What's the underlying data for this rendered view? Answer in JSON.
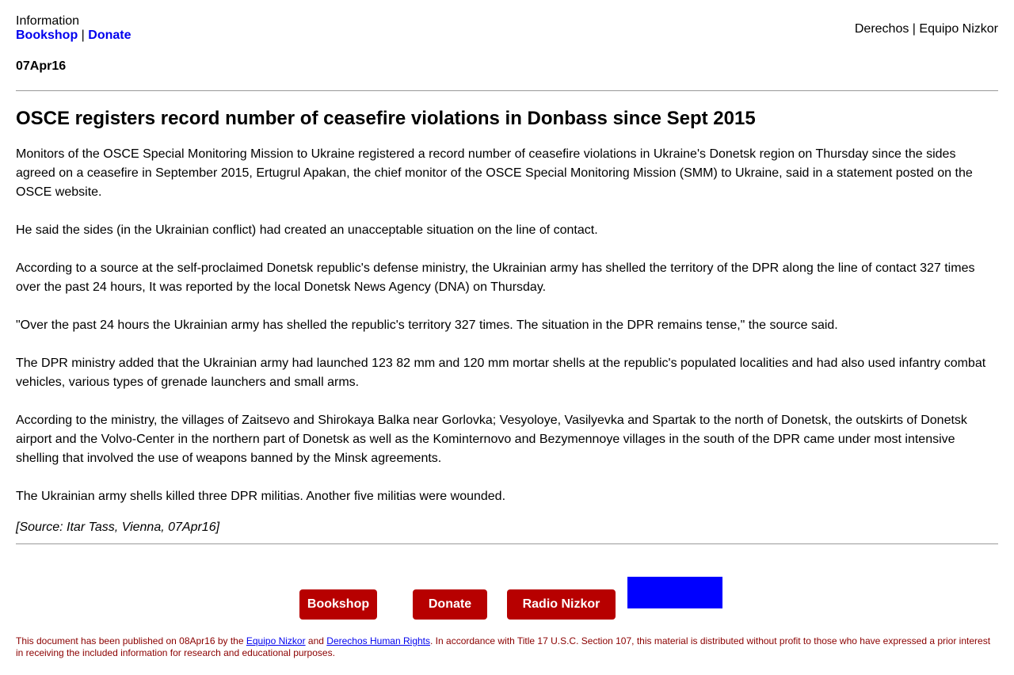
{
  "header": {
    "info_label": "Information",
    "bookshop_link": "Bookshop",
    "separator": "|",
    "donate_link": "Donate",
    "right_text": "Derechos | Equipo Nizkor",
    "date": "07Apr16"
  },
  "article": {
    "title": "OSCE registers record number of ceasefire violations in Donbass since Sept 2015",
    "paragraphs": [
      "Monitors of the OSCE Special Monitoring Mission to Ukraine registered a record number of ceasefire violations in Ukraine's Donetsk region on Thursday since the sides agreed on a ceasefire in September 2015, Ertugrul Apakan, the chief monitor of the OSCE Special Monitoring Mission (SMM) to Ukraine, said in a statement posted on the OSCE website.",
      "He said the sides (in the Ukrainian conflict) had created an unacceptable situation on the line of contact.",
      "According to a source at the self-proclaimed Donetsk republic's defense ministry, the Ukrainian army has shelled the territory of the DPR along the line of contact 327 times over the past 24 hours, It was reported by the local Donetsk News Agency (DNA) on Thursday.",
      "\"Over the past 24 hours the Ukrainian army has shelled the republic's territory 327 times. The situation in the DPR remains tense,\" the source said.",
      "The DPR ministry added that the Ukrainian army had launched 123 82 mm and 120 mm mortar shells at the republic's populated localities and had also used infantry combat vehicles, various types of grenade launchers and small arms.",
      "According to the ministry, the villages of Zaitsevo and Shirokaya Balka near Gorlovka; Vesyoloye, Vasilyevka and Spartak to the north of Donetsk, the outskirts of Donetsk airport and the Volvo-Center in the northern part of Donetsk as well as the Kominternovo and Bezymennoye villages in the south of the DPR came under most intensive shelling that involved the use of weapons banned by the Minsk agreements.",
      "The Ukrainian army shells killed three DPR militias. Another five militias were wounded."
    ],
    "source": "[Source: Itar Tass, Vienna, 07Apr16]"
  },
  "buttons": {
    "bookshop": "Bookshop",
    "donate": "Donate",
    "radio": "Radio Nizkor"
  },
  "footer": {
    "text_1": "This document has been published on 08Apr16 by the ",
    "link_1": "Equipo Nizkor",
    "text_2": " and ",
    "link_2": "Derechos Human Rights",
    "text_3": ". In accordance with Title 17 U.S.C. Section 107, this material is distributed without profit to those who have expressed a prior interest in receiving the included information for research and educational purposes."
  },
  "colors": {
    "link": "#0000ee",
    "button_bg": "#b70000",
    "footer_text": "#8b0000",
    "blue_box": "#0000ff"
  }
}
